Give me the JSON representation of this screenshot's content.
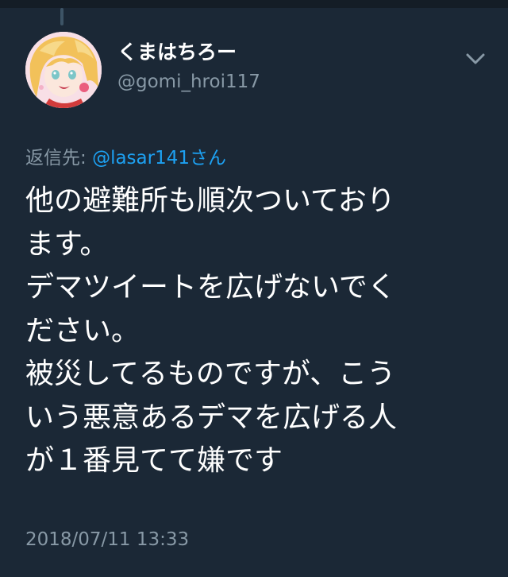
{
  "tweet": {
    "author": {
      "display_name": "くまはちろー",
      "handle": "@gomi_hroi117",
      "avatar_icon": "avatar-anime-portrait"
    },
    "menu_icon": "chevron-down-icon",
    "reply_to": {
      "prefix": "返信先: ",
      "mention": "@lasar141さん"
    },
    "text_lines": [
      "他の避難所も順次ついており",
      "ます。",
      "デマツイートを広げないでく",
      "ださい。",
      "被災してるものですが、こう",
      "いう悪意あるデマを広げる人",
      "が１番見てて嫌です"
    ],
    "timestamp": "2018/07/11 13:33"
  },
  "colors": {
    "background": "#1b2836",
    "primary_text": "#ffffff",
    "secondary_text": "#8899a6",
    "link": "#1da1f2"
  }
}
